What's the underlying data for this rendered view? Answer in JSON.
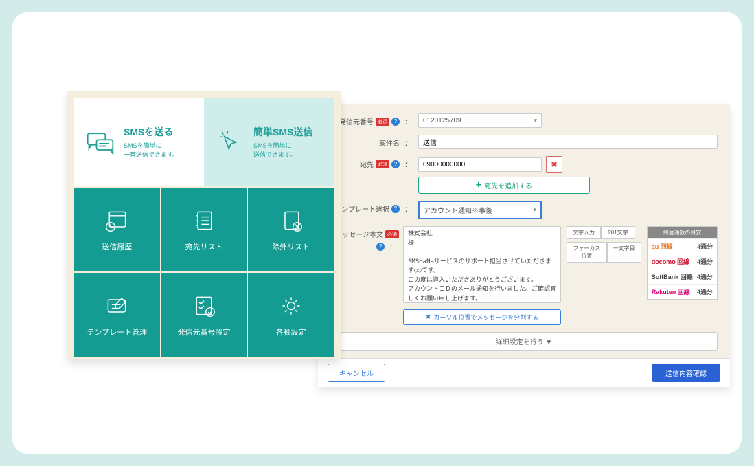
{
  "menu": {
    "card_send": {
      "title": "SMSを送る",
      "sub1": "SMSを簡単に",
      "sub2": "一斉送信できます。"
    },
    "card_easy": {
      "title": "簡単SMS送信",
      "sub1": "SMSを簡単に",
      "sub2": "送信できます。"
    },
    "tiles": [
      {
        "label": "送信履歴"
      },
      {
        "label": "宛先リスト"
      },
      {
        "label": "除外リスト"
      },
      {
        "label": "テンプレート管理"
      },
      {
        "label": "発信元番号設定"
      },
      {
        "label": "各種設定"
      }
    ]
  },
  "form": {
    "sender": {
      "label": "発信元番号",
      "required": "必須",
      "value": "0120125709"
    },
    "subject": {
      "label": "案件名",
      "value": "送信"
    },
    "dest": {
      "label": "宛先",
      "required": "必須",
      "value": "09000000000",
      "add_label": "宛先を追加する"
    },
    "template": {
      "label": "テンプレート選択",
      "value": "アカウント通知※事後"
    },
    "message": {
      "label": "メッセージ本文",
      "required": "必須",
      "body": "株式会社\n様\n\nSMSHaNaサービスのサポート担当させていただきます○○です。\nこの度は導入いただきありがとうございます。\nアカウントＩＤのメール通知を行いました。ご確認宜しくお願い申し上げます。",
      "counters": {
        "l1": "文字入力",
        "r1": "281文字",
        "l2": "フォーカス位置",
        "r2": "一文字目"
      },
      "split_label": "カーソル位置でメッセージを分割する"
    },
    "carriers": {
      "header": "到達通数の目安",
      "rows": [
        {
          "name": "au 回線",
          "cls": "c-au",
          "val": "4通分"
        },
        {
          "name": "docomo 回線",
          "cls": "c-docomo",
          "val": "4通分"
        },
        {
          "name": "SoftBank 回線",
          "cls": "c-softbank",
          "val": "4通分"
        },
        {
          "name": "Rakuten 回線",
          "cls": "c-rakuten",
          "val": "4通分"
        }
      ]
    },
    "detail_label": "詳細設定を行う ▼",
    "cancel": "キャンセル",
    "confirm": "送信内容確認"
  }
}
